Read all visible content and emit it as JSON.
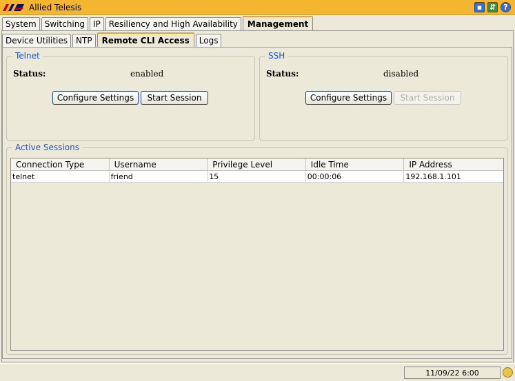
{
  "window": {
    "title": "Allied Telesis"
  },
  "main_tabs": [
    {
      "label": "System"
    },
    {
      "label": "Switching"
    },
    {
      "label": "IP"
    },
    {
      "label": "Resiliency and High Availability"
    },
    {
      "label": "Management",
      "active": true
    }
  ],
  "sub_tabs": [
    {
      "label": "Device Utilities"
    },
    {
      "label": "NTP"
    },
    {
      "label": "Remote CLI Access",
      "active": true
    },
    {
      "label": "Logs"
    }
  ],
  "telnet": {
    "legend": "Telnet",
    "status_label": "Status:",
    "status_value": "enabled",
    "configure_label": "Configure Settings",
    "start_label": "Start Session"
  },
  "ssh": {
    "legend": "SSH",
    "status_label": "Status:",
    "status_value": "disabled",
    "configure_label": "Configure Settings",
    "start_label": "Start Session",
    "start_disabled": true
  },
  "sessions": {
    "legend": "Active Sessions",
    "columns": [
      "Connection Type",
      "Username",
      "Privilege Level",
      "Idle Time",
      "IP Address"
    ],
    "rows": [
      [
        "telnet",
        "friend",
        "15",
        "00:00:06",
        "192.168.1.101"
      ]
    ]
  },
  "statusbar": {
    "datetime": "11/09/22 6:00"
  },
  "colors": {
    "titlebar": "#f4b531",
    "legend_text": "#1c55c4",
    "active_tab_accent": "#f2a31c"
  },
  "icons": [
    "save-icon",
    "export-icon",
    "help-icon",
    "tray-clock-icon"
  ]
}
